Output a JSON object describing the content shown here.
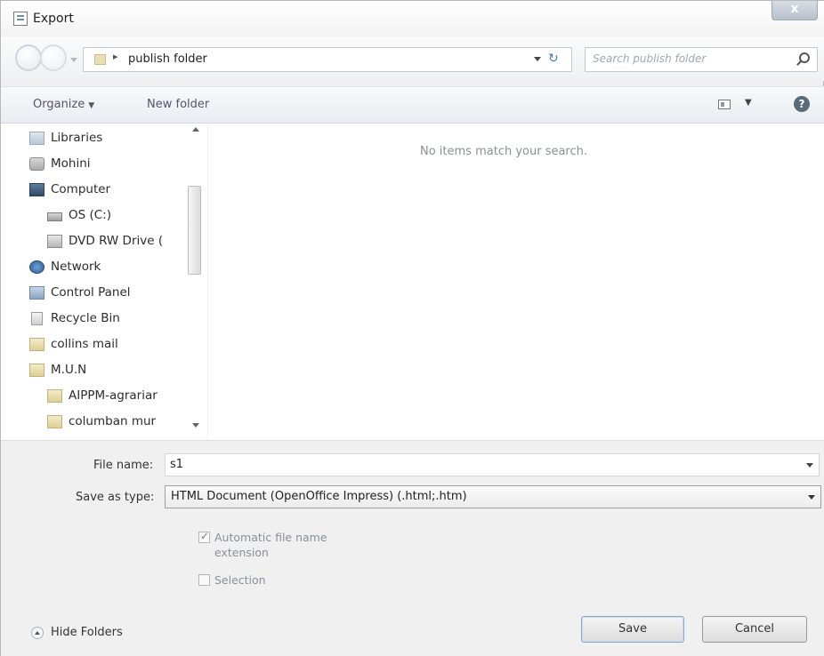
{
  "window": {
    "title": "Export",
    "close_glyph": "x"
  },
  "address": {
    "path_separator": "▸",
    "current_folder": "publish folder",
    "refresh_glyph": "↻",
    "search_placeholder": "Search publish folder"
  },
  "toolbar": {
    "organize_label": "Organize",
    "organize_caret": "▼",
    "new_folder_label": "New folder",
    "views_caret": "▼",
    "help_glyph": "?"
  },
  "nav": {
    "items": [
      {
        "label": "Libraries",
        "icon": "libraries-icon"
      },
      {
        "label": "Mohini",
        "icon": "user-icon"
      },
      {
        "label": "Computer",
        "icon": "computer-icon"
      },
      {
        "label": "OS (C:)",
        "icon": "drive-icon"
      },
      {
        "label": "DVD RW Drive (",
        "icon": "dvd-drive-icon"
      },
      {
        "label": "Network",
        "icon": "network-icon"
      },
      {
        "label": "Control Panel",
        "icon": "control-panel-icon"
      },
      {
        "label": "Recycle Bin",
        "icon": "recycle-bin-icon"
      },
      {
        "label": "collins mail",
        "icon": "folder-icon"
      },
      {
        "label": "M.U.N",
        "icon": "folder-icon"
      },
      {
        "label": "AIPPM-agrariar",
        "icon": "folder-icon"
      },
      {
        "label": "columban mur",
        "icon": "folder-icon"
      }
    ]
  },
  "content": {
    "empty_message": "No items match your search."
  },
  "form": {
    "file_name_label": "File name:",
    "file_name_value": "s1",
    "save_as_type_label": "Save as type:",
    "save_as_type_value": "HTML Document (OpenOffice Impress) (.html;.htm)",
    "auto_ext_label_line1": "Automatic file name",
    "auto_ext_label_line2": "extension",
    "auto_ext_checked": true,
    "selection_label": "Selection",
    "selection_checked": false
  },
  "footer": {
    "hide_folders_label": "Hide Folders",
    "save_label": "Save",
    "cancel_label": "Cancel"
  }
}
